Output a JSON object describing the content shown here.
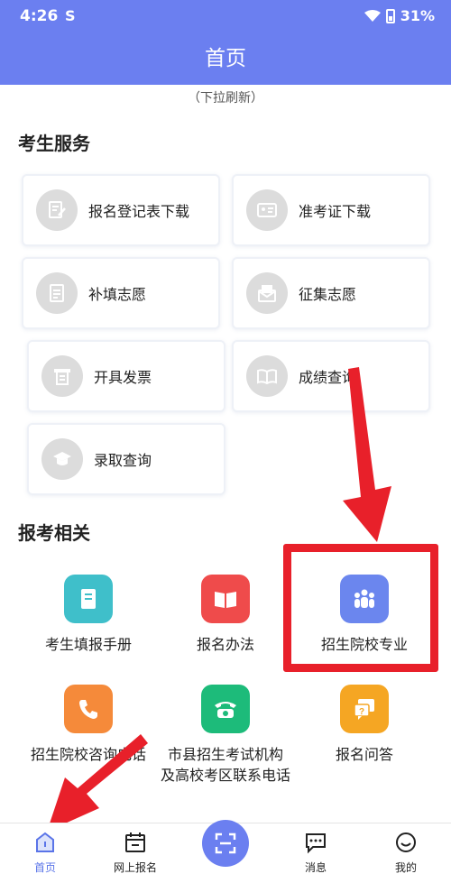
{
  "status_bar": {
    "time": "4:26",
    "app_indicator": "S",
    "battery": "31%"
  },
  "app_bar": {
    "title": "首页"
  },
  "pull_hint": "（下拉刷新）",
  "services": {
    "title": "考生服务",
    "items": [
      {
        "label": "报名登记表下载",
        "icon": "form-edit-icon"
      },
      {
        "label": "准考证下载",
        "icon": "id-card-icon"
      },
      {
        "label": "补填志愿",
        "icon": "document-icon"
      },
      {
        "label": "征集志愿",
        "icon": "letter-icon"
      },
      {
        "label": "开具发票",
        "icon": "invoice-icon"
      },
      {
        "label": "成绩查询",
        "icon": "book-open-icon"
      },
      {
        "label": "录取查询",
        "icon": "graduation-cap-icon"
      }
    ]
  },
  "related": {
    "title": "报考相关",
    "items": [
      {
        "label": "考生填报手册",
        "icon": "manual-book-icon",
        "color": "#3fbfca"
      },
      {
        "label": "报名办法",
        "icon": "open-book-icon",
        "color": "#ef4b4b"
      },
      {
        "label": "招生院校专业",
        "icon": "people-icon",
        "color": "#6b86ee"
      },
      {
        "label": "招生院校咨询电话",
        "icon": "phone-icon",
        "color": "#f58a3a"
      },
      {
        "label_line1": "市县招生考试机构",
        "label_line2": "及高校考区联系电话",
        "icon": "telephone-icon",
        "color": "#1dbb7a"
      },
      {
        "label": "报名问答",
        "icon": "question-chat-icon",
        "color": "#f5a623"
      }
    ]
  },
  "tab_bar": {
    "items": [
      {
        "label": "首页",
        "icon": "home-icon",
        "active": true
      },
      {
        "label": "网上报名",
        "icon": "calendar-icon"
      },
      {
        "label": "",
        "icon": "scan-icon"
      },
      {
        "label": "消息",
        "icon": "message-icon"
      },
      {
        "label": "我的",
        "icon": "profile-icon"
      }
    ]
  },
  "colors": {
    "primary": "#6b7ff0",
    "highlight_red": "#e8202a"
  }
}
